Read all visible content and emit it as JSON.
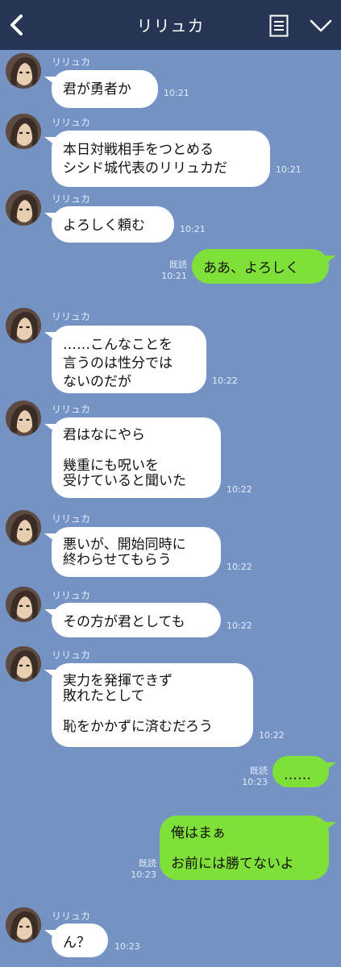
{
  "header": {
    "title": "リリュカ",
    "back_icon": "chevron-left-icon",
    "notes_icon": "notes-icon",
    "menu_icon": "chevron-down-icon"
  },
  "colors": {
    "background": "#7493c4",
    "header": "#253553",
    "incoming_bubble": "#ffffff",
    "outgoing_bubble": "#80e03a"
  },
  "messages": [
    {
      "sender": "リリュカ",
      "text": "君が勇者か",
      "time": "10:21"
    },
    {
      "sender": "リリュカ",
      "text": "本日対戦相手をつとめる\nシシド城代表のリリュカだ",
      "time": "10:21"
    },
    {
      "sender": "リリュカ",
      "text": "よろしく頼む",
      "time": "10:21"
    },
    {
      "read": "既読",
      "text": "ああ、よろしく",
      "time": "10:21"
    },
    {
      "sender": "リリュカ",
      "text": "……こんなことを\n言うのは性分では\nないのだが",
      "time": "10:22"
    },
    {
      "sender": "リリュカ",
      "text": "君はなにやら\n\n幾重にも呪いを\n受けていると聞いた",
      "time": "10:22"
    },
    {
      "sender": "リリュカ",
      "text": "悪いが、開始同時に\n終わらせてもらう",
      "time": "10:22"
    },
    {
      "sender": "リリュカ",
      "text": "その方が君としても",
      "time": "10:22"
    },
    {
      "sender": "リリュカ",
      "text": "実力を発揮できず\n敗れたとして\n\n恥をかかずに済むだろう",
      "time": "10:22"
    },
    {
      "read": "既読",
      "text": "……",
      "time": "10:23"
    },
    {
      "read": "既読",
      "text": "俺はまぁ\n\nお前には勝てないよ",
      "time": "10:23"
    },
    {
      "sender": "リリュカ",
      "text": "ん？",
      "time": "10:23"
    }
  ]
}
